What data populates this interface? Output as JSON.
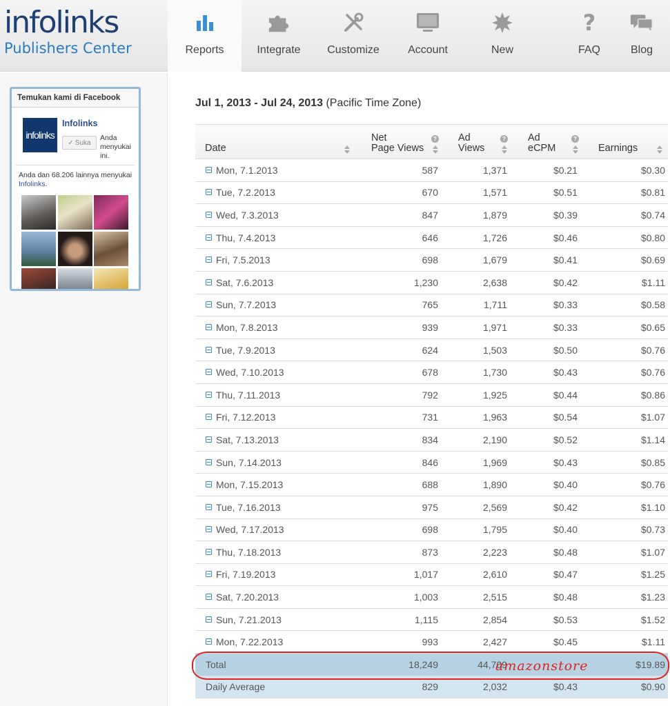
{
  "logo": {
    "main": "infolinks",
    "sub": "Publishers Center"
  },
  "nav": [
    {
      "label": "Reports",
      "icon": "bar-chart-icon",
      "active": true
    },
    {
      "label": "Integrate",
      "icon": "puzzle-icon"
    },
    {
      "label": "Customize",
      "icon": "tools-icon"
    },
    {
      "label": "Account",
      "icon": "monitor-icon"
    },
    {
      "label": "New",
      "icon": "starburst-icon"
    },
    {
      "label": "FAQ",
      "icon": "question-icon"
    },
    {
      "label": "Blog",
      "icon": "chat-icon"
    }
  ],
  "facebook": {
    "title": "Temukan kami di Facebook",
    "page_name": "Infolinks",
    "logo_text": "infolinks",
    "like_button": "Suka",
    "like_text": "Anda menyukai ini.",
    "count_text": "Anda dan 68.206 lainnya menyukai",
    "count_link": "Infolinks",
    "count_suffix": "."
  },
  "report": {
    "range": "Jul 1, 2013 - Jul 24, 2013",
    "timezone": "(Pacific Time Zone)",
    "columns": {
      "date": "Date",
      "net_page_views": [
        "Net",
        "Page Views"
      ],
      "ad_views": [
        "Ad",
        "Views"
      ],
      "ad_ecpm": [
        "Ad",
        "eCPM"
      ],
      "earnings": "Earnings"
    },
    "rows": [
      [
        "Mon, 7.1.2013",
        "587",
        "1,371",
        "$0.21",
        "$0.30"
      ],
      [
        "Tue, 7.2.2013",
        "670",
        "1,571",
        "$0.51",
        "$0.81"
      ],
      [
        "Wed, 7.3.2013",
        "847",
        "1,879",
        "$0.39",
        "$0.74"
      ],
      [
        "Thu, 7.4.2013",
        "646",
        "1,726",
        "$0.46",
        "$0.80"
      ],
      [
        "Fri, 7.5.2013",
        "698",
        "1,679",
        "$0.41",
        "$0.69"
      ],
      [
        "Sat, 7.6.2013",
        "1,230",
        "2,638",
        "$0.42",
        "$1.11"
      ],
      [
        "Sun, 7.7.2013",
        "765",
        "1,711",
        "$0.33",
        "$0.58"
      ],
      [
        "Mon, 7.8.2013",
        "939",
        "1,971",
        "$0.33",
        "$0.65"
      ],
      [
        "Tue, 7.9.2013",
        "624",
        "1,503",
        "$0.50",
        "$0.76"
      ],
      [
        "Wed, 7.10.2013",
        "678",
        "1,730",
        "$0.43",
        "$0.76"
      ],
      [
        "Thu, 7.11.2013",
        "792",
        "1,925",
        "$0.44",
        "$0.86"
      ],
      [
        "Fri, 7.12.2013",
        "731",
        "1,963",
        "$0.54",
        "$1.07"
      ],
      [
        "Sat, 7.13.2013",
        "834",
        "2,190",
        "$0.52",
        "$1.14"
      ],
      [
        "Sun, 7.14.2013",
        "846",
        "1,969",
        "$0.43",
        "$0.85"
      ],
      [
        "Mon, 7.15.2013",
        "688",
        "1,890",
        "$0.40",
        "$0.76"
      ],
      [
        "Tue, 7.16.2013",
        "975",
        "2,569",
        "$0.42",
        "$1.10"
      ],
      [
        "Wed, 7.17.2013",
        "698",
        "1,795",
        "$0.40",
        "$0.73"
      ],
      [
        "Thu, 7.18.2013",
        "873",
        "2,223",
        "$0.48",
        "$1.07"
      ],
      [
        "Fri, 7.19.2013",
        "1,017",
        "2,610",
        "$0.47",
        "$1.25"
      ],
      [
        "Sat, 7.20.2013",
        "1,003",
        "2,515",
        "$0.48",
        "$1.23"
      ],
      [
        "Sun, 7.21.2013",
        "1,115",
        "2,854",
        "$0.53",
        "$1.52"
      ],
      [
        "Mon, 7.22.2013",
        "993",
        "2,427",
        "$0.45",
        "$1.11"
      ]
    ],
    "total": [
      "Total",
      "18,249",
      "44,709",
      "",
      "$19.89"
    ],
    "average": [
      "Daily Average",
      "829",
      "2,032",
      "$0.43",
      "$0.90"
    ]
  },
  "annotation": {
    "watermark": "amazonstore",
    "color": "#dd2222"
  },
  "colors": {
    "accent": "#2a7bc1",
    "total_row": "#b7d3e3",
    "average_row": "#d3e6f0"
  }
}
